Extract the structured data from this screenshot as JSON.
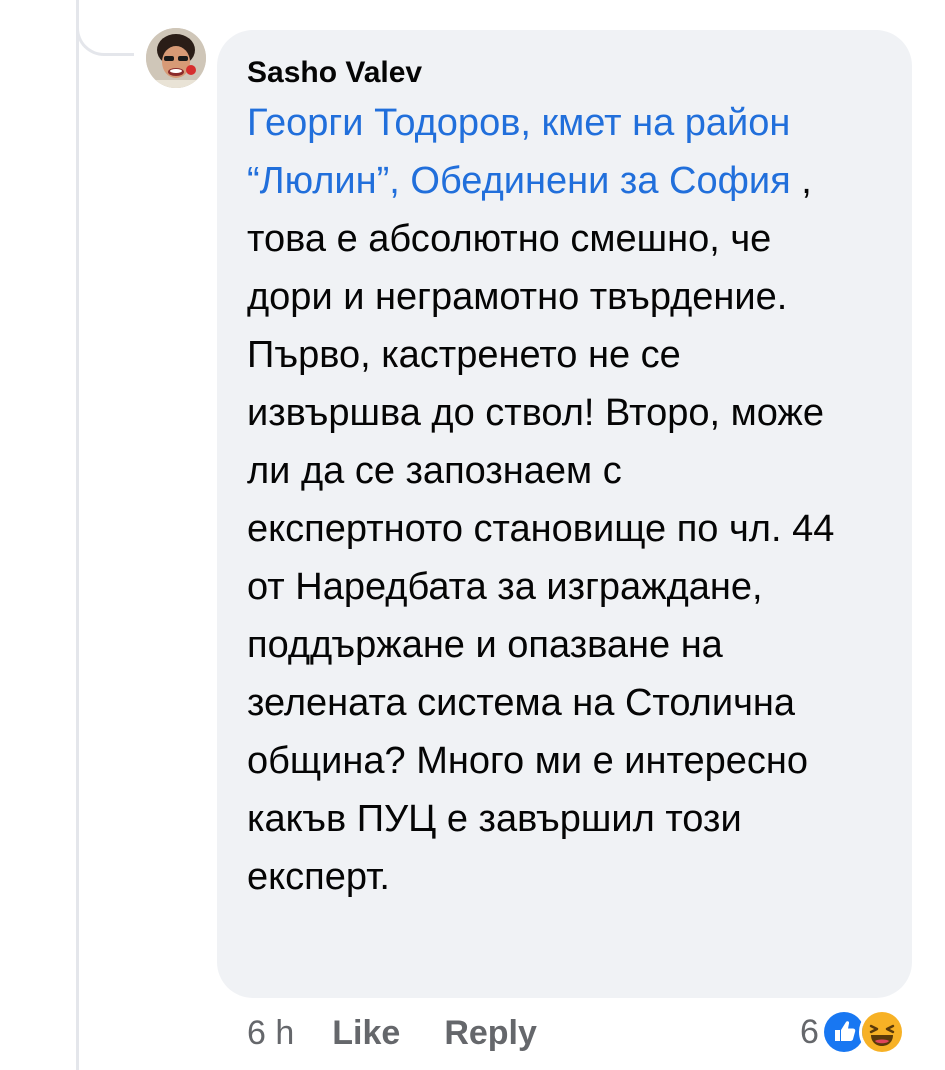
{
  "comment": {
    "author": "Sasho Valev",
    "mention": "Георги Тодоров, кмет на район “Люлин”, Обединени за София",
    "text": " , това е абсолютно смешно, че дори и неграмотно твърдение. Първо, кастренето не се извършва до ствол! Второ, може ли да се запознаем с експертното становище по чл. 44 от Наредбата за изграждане, поддържане и опазване на зелената система на Столична община? Много ми е интересно какъв ПУЦ е завършил този експерт."
  },
  "actions": {
    "time": "6 h",
    "like_label": "Like",
    "reply_label": "Reply"
  },
  "reactions": {
    "count": "6",
    "icons": [
      "like-icon",
      "haha-icon"
    ]
  },
  "colors": {
    "mention": "#216fdb",
    "bubble": "#f0f2f5",
    "secondary_text": "#65676b",
    "like_blue": "#1877f2",
    "haha_yellow": "#f7b125"
  }
}
